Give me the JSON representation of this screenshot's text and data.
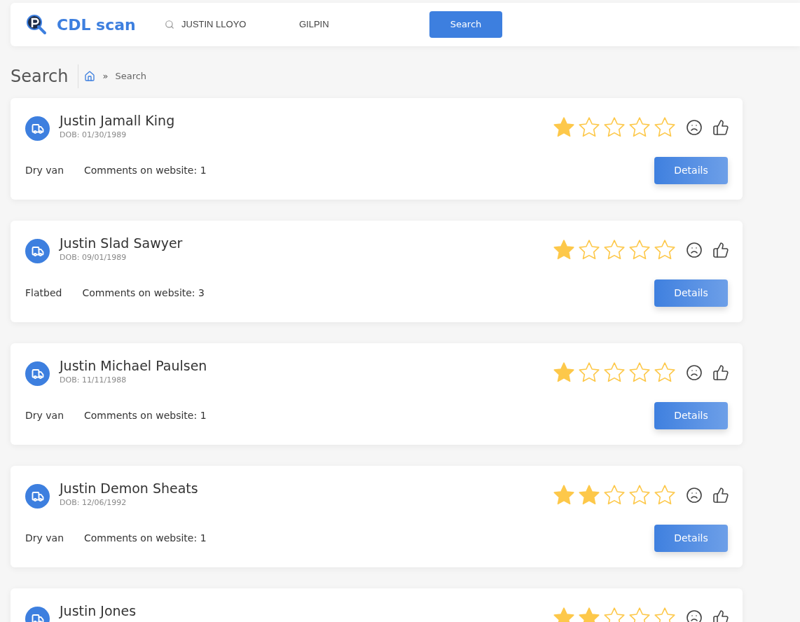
{
  "header": {
    "logo_text": "CDL scan",
    "search_name": {
      "value": "JUSTIN LLOYO"
    },
    "search_last": {
      "value": "GILPIN"
    },
    "search_button": "Search"
  },
  "page": {
    "title": "Search",
    "breadcrumb": {
      "separator": "»",
      "current": "Search"
    }
  },
  "results": [
    {
      "name": "Justin Jamall King",
      "dob": "DOB: 01/30/1989",
      "stars": 1,
      "type": "Dry van",
      "comments": "Comments on website: 1",
      "button": "Details"
    },
    {
      "name": "Justin Slad Sawyer",
      "dob": "DOB: 09/01/1989",
      "stars": 1,
      "type": "Flatbed",
      "comments": "Comments on website: 3",
      "button": "Details"
    },
    {
      "name": "Justin Michael Paulsen",
      "dob": "DOB: 11/11/1988",
      "stars": 1,
      "type": "Dry van",
      "comments": "Comments on website: 1",
      "button": "Details"
    },
    {
      "name": "Justin Demon Sheats",
      "dob": "DOB: 12/06/1992",
      "stars": 2,
      "type": "Dry van",
      "comments": "Comments on website: 1",
      "button": "Details"
    },
    {
      "name": "Justin Jones",
      "stars": 2
    }
  ]
}
